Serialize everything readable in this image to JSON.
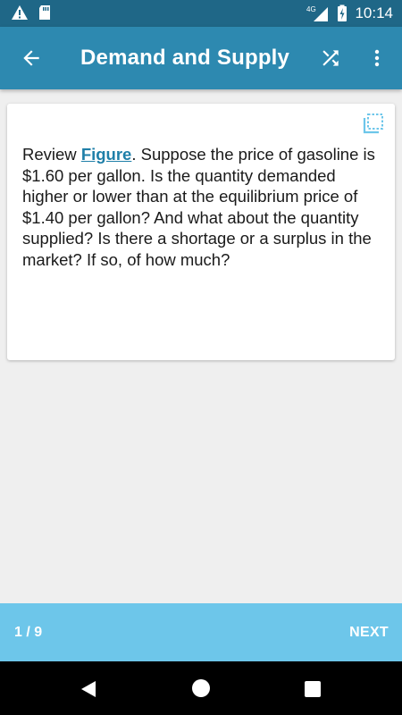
{
  "status_bar": {
    "time": "10:14",
    "network_label": "4G",
    "icons": [
      "warning-icon",
      "sd-card-icon",
      "signal-icon",
      "battery-charging-icon"
    ]
  },
  "app_bar": {
    "title": "Demand and Supply",
    "icons": [
      "arrow-back-icon",
      "shuffle-icon",
      "more-vert-icon"
    ]
  },
  "card": {
    "text_before_link": "Review ",
    "link_text": "Figure",
    "text_after_link": ". Suppose the price of gasoline is $1.60 per gallon. Is the quantity demanded higher or lower than at the equilibrium price of $1.40 per gallon? And what about the quantity supplied? Is there a shortage or a surplus in the market? If so, of how much?",
    "icon": "fullscreen-icon"
  },
  "bottom_bar": {
    "page_indicator": "1 / 9",
    "next_label": "NEXT"
  },
  "colors": {
    "status_bar": "#1f6787",
    "app_bar": "#2d89b0",
    "bottom_bar": "#6dc6ea",
    "link": "#1f7fa8",
    "background": "#efefef"
  }
}
